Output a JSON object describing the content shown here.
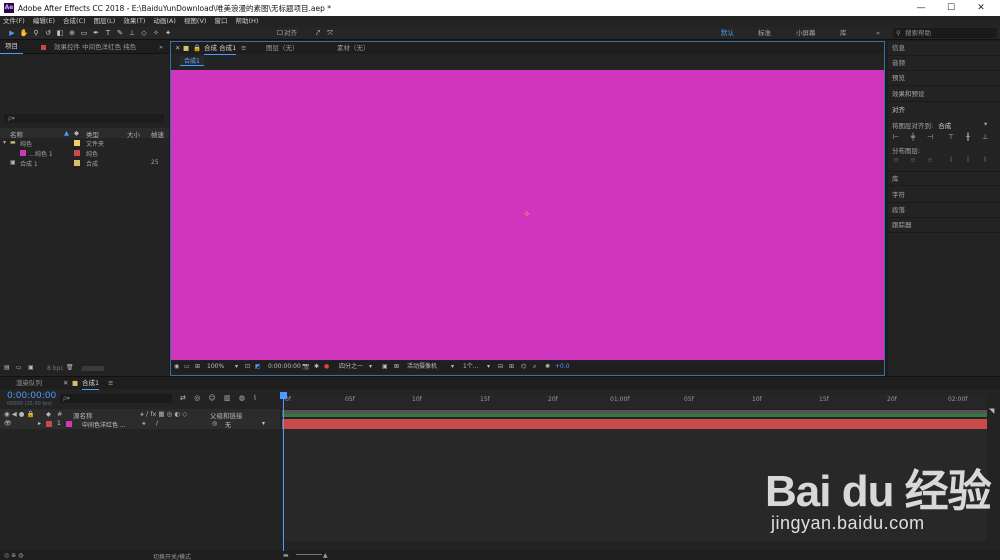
{
  "window": {
    "title": "Adobe After Effects CC 2018 - E:\\BaiduYunDownload\\唯美浪漫的素图\\无标题项目.aep *",
    "logo": "Ae",
    "minimize": "—",
    "maximize": "☐",
    "close": "✕"
  },
  "menu": [
    "文件(F)",
    "编辑(E)",
    "合成(C)",
    "图层(L)",
    "效果(T)",
    "动画(A)",
    "视图(V)",
    "窗口",
    "帮助(H)"
  ],
  "toolbar": {
    "align_label": "对齐",
    "workspaces": [
      "默认",
      "标准",
      "小屏幕",
      "库"
    ],
    "workspace_more": "»",
    "search_placeholder": "搜索帮助"
  },
  "project": {
    "tabs": [
      "项目",
      "效果控件 中间色洋红色 纯色"
    ],
    "search_placeholder": "ρ▾",
    "columns": [
      "名称",
      "类型",
      "大小",
      "帧速"
    ],
    "rows": [
      {
        "name": "纯色",
        "type": "文件夹",
        "size": "",
        "color": "#e8d36a"
      },
      {
        "name": "…纯色 1",
        "type": "纯色",
        "size": "",
        "color": "#d035bd"
      },
      {
        "name": "合成 1",
        "type": "合成",
        "size": "25",
        "color": "#d9c16a"
      }
    ],
    "bpc": "8 bpc"
  },
  "viewer": {
    "tabs": [
      "合成 合成1",
      "图层（无）",
      "素材（无）"
    ],
    "breadcrumb": "合成1",
    "zoom": "100%",
    "timecode": "0:00:00:00",
    "resolution": "四分之一",
    "camera": "活动摄像机",
    "views": "1个...",
    "exposure": "+0.0",
    "canvas_color": "#d035bd"
  },
  "right_panel": {
    "items": [
      "信息",
      "音频",
      "预览",
      "效果和预设"
    ],
    "align_title": "对齐",
    "align_to_label": "将图层对齐到:",
    "align_to_value": "合成",
    "distribute_label": "分布图层:",
    "items_bottom": [
      "库",
      "字符",
      "段落",
      "跟踪器"
    ]
  },
  "timeline": {
    "tabs": [
      "渲染队列",
      "合成1"
    ],
    "timecode": "0:00:00:00",
    "timecode_sub": "00000 (25.00 fps)",
    "search_placeholder": "ρ▾",
    "header": [
      "#",
      "源名称",
      "父级和链接"
    ],
    "layer": {
      "index": "1",
      "name": "中间色洋红色 ...",
      "parent": "无",
      "color": "#c94a4a"
    },
    "ruler": [
      "0f",
      "05f",
      "10f",
      "15f",
      "20f",
      "01:00f",
      "05f",
      "10f",
      "15f",
      "20f",
      "02:00f"
    ],
    "toggle_label": "切换开关/模式"
  },
  "watermark": {
    "logo": "Bai du 经验",
    "url": "jingyan.baidu.com"
  }
}
